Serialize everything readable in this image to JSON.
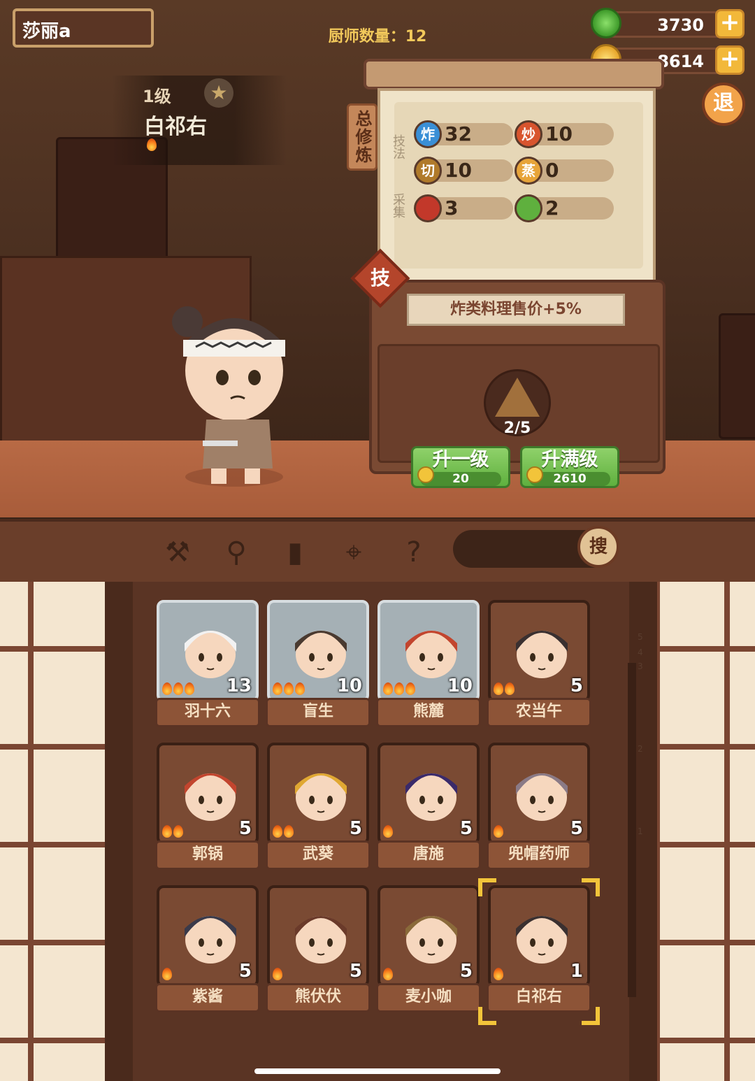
{
  "header": {
    "player_name": "莎丽a",
    "chef_count_label": "厨师数量：12",
    "jade": "3730",
    "coins": "8614",
    "exit_label": "退"
  },
  "selected_chef": {
    "level": "1级",
    "name": "白祁右"
  },
  "training": {
    "tab_label": "总修炼",
    "technique_label": "技法",
    "gather_label": "采集",
    "skills": [
      {
        "icon": "炸",
        "value": "32",
        "color": "#3a8fd6"
      },
      {
        "icon": "炒",
        "value": "10",
        "color": "#d8542e"
      },
      {
        "icon": "切",
        "value": "10",
        "color": "#b07a2a"
      },
      {
        "icon": "蒸",
        "value": "0",
        "color": "#e7a43a"
      }
    ],
    "gathers": [
      {
        "icon": "meat-icon",
        "value": "3",
        "color": "#c2382a"
      },
      {
        "icon": "vegetable-icon",
        "value": "2",
        "color": "#5fb03e"
      }
    ],
    "tech_badge": "技",
    "bonus_text": "炸类料理售价+5%",
    "progress": "2/5",
    "upgrade_one": {
      "label": "升一级",
      "cost": "20"
    },
    "upgrade_max": {
      "label": "升满级",
      "cost": "2610"
    }
  },
  "toolbar": {
    "search_label": "搜",
    "icons": [
      "spatula-icon",
      "ladle-icon",
      "jar-icon",
      "location-icon",
      "map-question-icon"
    ]
  },
  "chefs": [
    {
      "name": "羽十六",
      "level": "13",
      "flames": 3,
      "rare": true
    },
    {
      "name": "盲生",
      "level": "10",
      "flames": 3,
      "rare": true
    },
    {
      "name": "熊麓",
      "level": "10",
      "flames": 3,
      "rare": true
    },
    {
      "name": "农当午",
      "level": "5",
      "flames": 2,
      "rare": false
    },
    {
      "name": "郭锅",
      "level": "5",
      "flames": 2,
      "rare": false
    },
    {
      "name": "武葵",
      "level": "5",
      "flames": 2,
      "rare": false
    },
    {
      "name": "唐施",
      "level": "5",
      "flames": 1,
      "rare": false
    },
    {
      "name": "兜帽药师",
      "level": "5",
      "flames": 1,
      "rare": false
    },
    {
      "name": "紫酱",
      "level": "5",
      "flames": 1,
      "rare": false
    },
    {
      "name": "熊伏伏",
      "level": "5",
      "flames": 1,
      "rare": false
    },
    {
      "name": "麦小咖",
      "level": "5",
      "flames": 1,
      "rare": false
    },
    {
      "name": "白祁右",
      "level": "1",
      "flames": 1,
      "rare": false,
      "selected": true
    }
  ],
  "ruler_ticks": [
    "5",
    "4",
    "3",
    "2",
    "1"
  ],
  "colors": {
    "accent_green": "#5fb03e",
    "gold": "#f2c43a",
    "wood": "#5a3424"
  }
}
